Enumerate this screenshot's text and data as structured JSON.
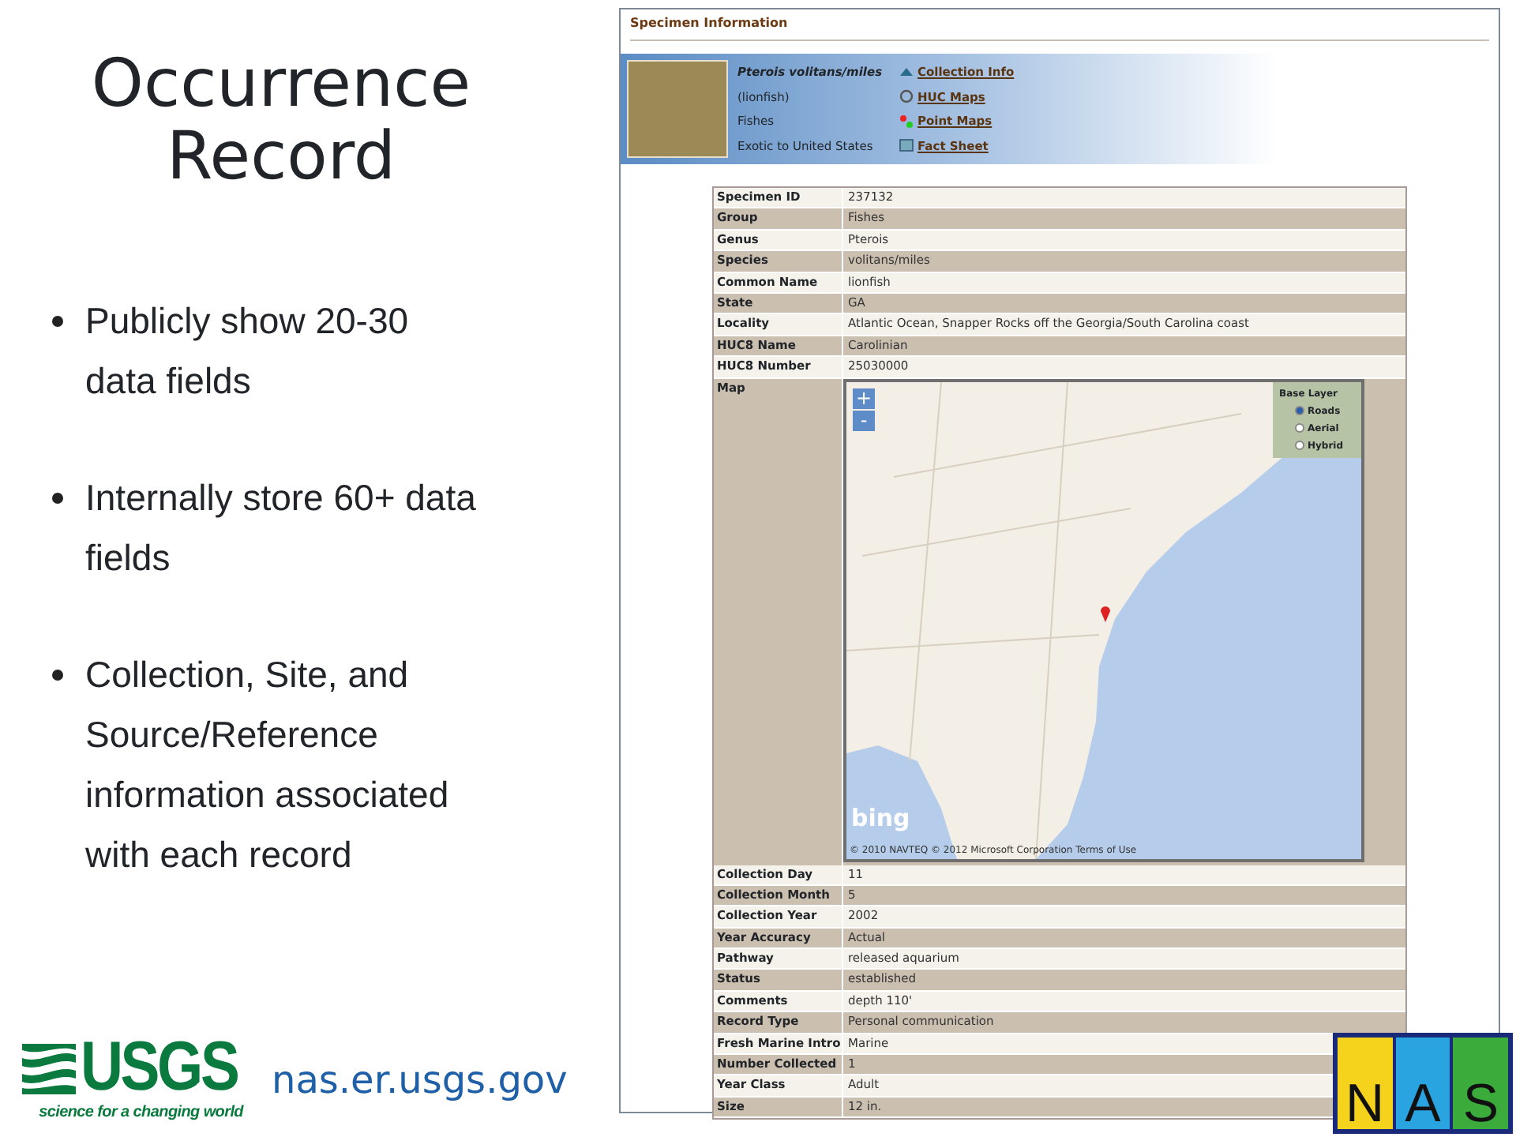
{
  "slide": {
    "title": "Occurrence Record",
    "bullets": [
      "Publicly show 20-30 data fields",
      "Internally store 60+ data fields",
      "Collection, Site, and Source/Reference information associated with each record"
    ],
    "usgs_logo": {
      "name": "USGS",
      "tagline": "science for a changing world"
    },
    "footer_url": "nas.er.usgs.gov",
    "nas_logo": {
      "letters": [
        "N",
        "A",
        "S"
      ]
    }
  },
  "page": {
    "section_title": "Specimen Information",
    "summary": {
      "lines": [
        {
          "kind": "species",
          "text": "Pterois volitans/miles"
        },
        {
          "kind": "plain",
          "text": "(lionfish)"
        },
        {
          "kind": "plain",
          "text": "Fishes"
        },
        {
          "kind": "plain",
          "text": "Exotic to United States"
        }
      ],
      "links": [
        {
          "kind": "collection",
          "text": "Collection Info"
        },
        {
          "kind": "huc",
          "text": "HUC Maps"
        },
        {
          "kind": "point",
          "text": "Point Maps"
        },
        {
          "kind": "fact",
          "text": "Fact Sheet"
        }
      ]
    },
    "rows": [
      {
        "kind": "text",
        "label": "Specimen ID",
        "value": "237132"
      },
      {
        "kind": "text",
        "label": "Group",
        "value": "Fishes"
      },
      {
        "kind": "text",
        "label": "Genus",
        "value": "Pterois"
      },
      {
        "kind": "text",
        "label": "Species",
        "value": "volitans/miles"
      },
      {
        "kind": "text",
        "label": "Common Name",
        "value": "lionfish"
      },
      {
        "kind": "text",
        "label": "State",
        "value": "GA"
      },
      {
        "kind": "text",
        "label": "Locality",
        "value": "Atlantic Ocean, Snapper Rocks off the Georgia/South Carolina coast"
      },
      {
        "kind": "text",
        "label": "HUC8 Name",
        "value": "Carolinian"
      },
      {
        "kind": "text",
        "label": "HUC8 Number",
        "value": "25030000"
      },
      {
        "kind": "map",
        "label": "Map"
      },
      {
        "kind": "text",
        "label": "Collection Day",
        "value": "11"
      },
      {
        "kind": "text",
        "label": "Collection Month",
        "value": "5"
      },
      {
        "kind": "text",
        "label": "Collection Year",
        "value": "2002"
      },
      {
        "kind": "text",
        "label": "Year Accuracy",
        "value": "Actual"
      },
      {
        "kind": "text",
        "label": "Pathway",
        "value": "released aquarium"
      },
      {
        "kind": "text",
        "label": "Status",
        "value": "established"
      },
      {
        "kind": "text",
        "label": "Comments",
        "value": "depth 110'"
      },
      {
        "kind": "text",
        "label": "Record Type",
        "value": "Personal communication"
      },
      {
        "kind": "text",
        "label": "Fresh Marine Intro",
        "value": "Marine"
      },
      {
        "kind": "text",
        "label": "Number Collected",
        "value": "1"
      },
      {
        "kind": "text",
        "label": "Year Class",
        "value": "Adult"
      },
      {
        "kind": "text",
        "label": "Size",
        "value": "12 in."
      }
    ],
    "map": {
      "zoom_in": "+",
      "zoom_out": "-",
      "base_layer": {
        "title": "Base Layer",
        "options": [
          {
            "label": "Roads",
            "selected": true
          },
          {
            "label": "Aerial",
            "selected": false
          },
          {
            "label": "Hybrid",
            "selected": false
          }
        ]
      },
      "logo": "bing",
      "attribution": "© 2010 NAVTEQ © 2012 Microsoft Corporation",
      "terms_link": "Terms of Use"
    }
  }
}
